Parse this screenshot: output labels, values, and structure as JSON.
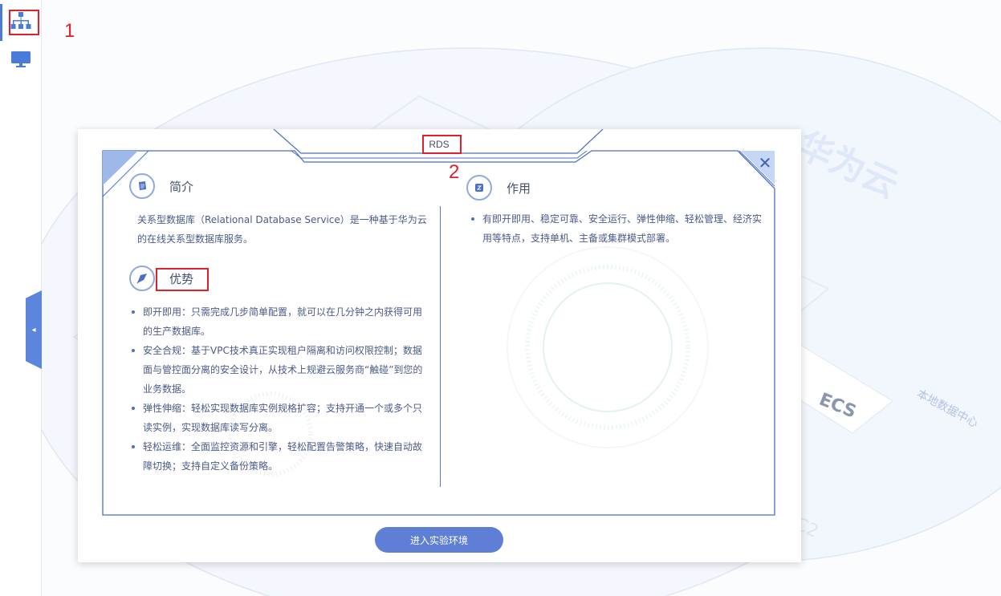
{
  "dialog": {
    "title": "RDS",
    "close_glyph": "✕",
    "enter_button": "进入实验环境"
  },
  "intro": {
    "heading": "简介",
    "text": "关系型数据库（Relational Database Service）是一种基于华为云的在线关系型数据库服务。"
  },
  "advantages": {
    "heading": "优势",
    "items": [
      "即开即用：只需完成几步简单配置，就可以在几分钟之内获得可用的生产数据库。",
      "安全合规：基于VPC技术真正实现租户隔离和访问权限控制；数据面与管控面分离的安全设计，从技术上规避云服务商“触碰”到您的业务数据。",
      "弹性伸缩：轻松实现数据库实例规格扩容；支持开通一个或多个只读实例，实现数据库读写分离。",
      "轻松运维：全面监控资源和引擎，轻松配置告警策略，快速自动故障切换；支持自定义备份策略。"
    ]
  },
  "usage": {
    "heading": "作用",
    "items": [
      "有即开即用、稳定可靠、安全运行、弹性伸缩、轻松管理、经济实用等特点，支持单机、主备或集群模式部署。"
    ]
  },
  "annotations": {
    "label_1": "1",
    "label_2": "2"
  },
  "background": {
    "brand_text": "华为云",
    "ecs_label": "ECS",
    "local_dc_label": "本地数据中心",
    "partial_label": "C2"
  },
  "rail": {
    "items": [
      "topology-icon",
      "monitor-icon"
    ],
    "collapse_glyph": "◂"
  },
  "colors": {
    "accent": "#5f7fd6",
    "frame_blue": "#4a6fc4",
    "annotation_red": "#e0202a"
  }
}
